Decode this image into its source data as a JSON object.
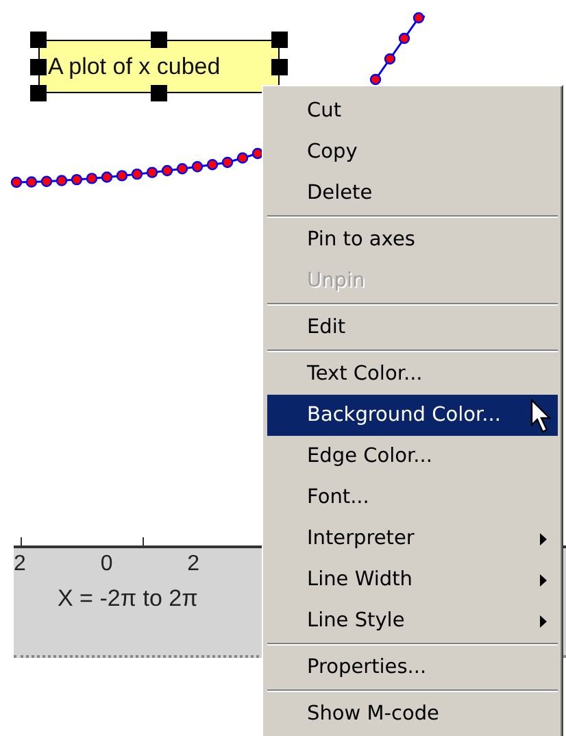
{
  "annotation": {
    "text": "A plot of x cubed",
    "selected": true
  },
  "axes": {
    "tick_labels": [
      "2",
      "0",
      "2"
    ],
    "xlabel": "X = -2π to 2π"
  },
  "context_menu": {
    "groups": [
      [
        {
          "label": "Cut",
          "disabled": false,
          "selected": false,
          "submenu": false
        },
        {
          "label": "Copy",
          "disabled": false,
          "selected": false,
          "submenu": false
        },
        {
          "label": "Delete",
          "disabled": false,
          "selected": false,
          "submenu": false
        }
      ],
      [
        {
          "label": "Pin to axes",
          "disabled": false,
          "selected": false,
          "submenu": false
        },
        {
          "label": "Unpin",
          "disabled": true,
          "selected": false,
          "submenu": false
        }
      ],
      [
        {
          "label": "Edit",
          "disabled": false,
          "selected": false,
          "submenu": false
        }
      ],
      [
        {
          "label": "Text Color...",
          "disabled": false,
          "selected": false,
          "submenu": false
        },
        {
          "label": "Background Color...",
          "disabled": false,
          "selected": true,
          "submenu": false
        },
        {
          "label": "Edge Color...",
          "disabled": false,
          "selected": false,
          "submenu": false
        },
        {
          "label": "Font...",
          "disabled": false,
          "selected": false,
          "submenu": false
        },
        {
          "label": "Interpreter",
          "disabled": false,
          "selected": false,
          "submenu": true
        },
        {
          "label": "Line Width",
          "disabled": false,
          "selected": false,
          "submenu": true
        },
        {
          "label": "Line Style",
          "disabled": false,
          "selected": false,
          "submenu": true
        }
      ],
      [
        {
          "label": "Properties...",
          "disabled": false,
          "selected": false,
          "submenu": false
        }
      ],
      [
        {
          "label": "Show M-code",
          "disabled": false,
          "selected": false,
          "submenu": false
        }
      ]
    ]
  }
}
